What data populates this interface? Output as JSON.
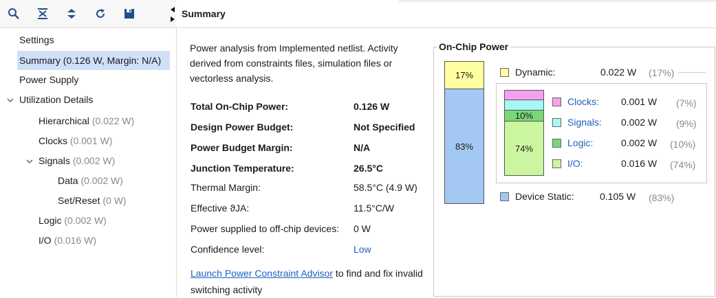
{
  "header": {
    "title": "Summary"
  },
  "sidebar": {
    "items": [
      {
        "label": "Settings",
        "meta": ""
      },
      {
        "label": "Summary (0.126 W, Margin: N/A)",
        "meta": ""
      },
      {
        "label": "Power Supply",
        "meta": ""
      },
      {
        "label": "Utilization Details",
        "meta": ""
      },
      {
        "label": "Hierarchical",
        "meta": "(0.022 W)"
      },
      {
        "label": "Clocks",
        "meta": "(0.001 W)"
      },
      {
        "label": "Signals",
        "meta": "(0.002 W)"
      },
      {
        "label": "Data",
        "meta": "(0.002 W)"
      },
      {
        "label": "Set/Reset",
        "meta": "(0 W)"
      },
      {
        "label": "Logic",
        "meta": "(0.002 W)"
      },
      {
        "label": "I/O",
        "meta": "(0.016 W)"
      }
    ]
  },
  "main": {
    "description": "Power analysis from Implemented netlist. Activity derived from constraints files, simulation files or vectorless analysis.",
    "rows": [
      {
        "label": "Total On-Chip Power:",
        "value": "0.126 W"
      },
      {
        "label": "Design Power Budget:",
        "value": "Not Specified"
      },
      {
        "label": "Power Budget Margin:",
        "value": "N/A"
      },
      {
        "label": "Junction Temperature:",
        "value": "26.5°C"
      },
      {
        "label": "Thermal Margin:",
        "value": "58.5°C (4.9 W)"
      },
      {
        "label": "Effective ϑJA:",
        "value": "11.5°C/W"
      },
      {
        "label": "Power supplied to off-chip devices:",
        "value": "0 W"
      },
      {
        "label": "Confidence level:",
        "value": "Low"
      }
    ],
    "advisor_link": "Launch Power Constraint Advisor",
    "advisor_text": " to find and fix invalid switching activity"
  },
  "onchip": {
    "title": "On-Chip Power",
    "main_bar": {
      "dynamic_pct_label": "17%",
      "static_pct_label": "83%",
      "dynamic_fraction": 0.17
    },
    "sub_bar": {
      "signals_label": "10%",
      "io_label": "74%"
    },
    "dynamic": {
      "label": "Dynamic:",
      "value": "0.022 W",
      "pct": "(17%)",
      "color": "#ffffa0"
    },
    "breakdown": [
      {
        "label": "Clocks:",
        "value": "0.001 W",
        "pct": "(7%)",
        "color": "#f6a0f0"
      },
      {
        "label": "Signals:",
        "value": "0.002 W",
        "pct": "(9%)",
        "color": "#a8f6f6"
      },
      {
        "label": "Logic:",
        "value": "0.002 W",
        "pct": "(10%)",
        "color": "#78d878"
      },
      {
        "label": "I/O:",
        "value": "0.016 W",
        "pct": "(74%)",
        "color": "#ccf5a0"
      }
    ],
    "static": {
      "label": "Device Static:",
      "value": "0.105 W",
      "pct": "(83%)",
      "color": "#a4c8f4"
    }
  }
}
